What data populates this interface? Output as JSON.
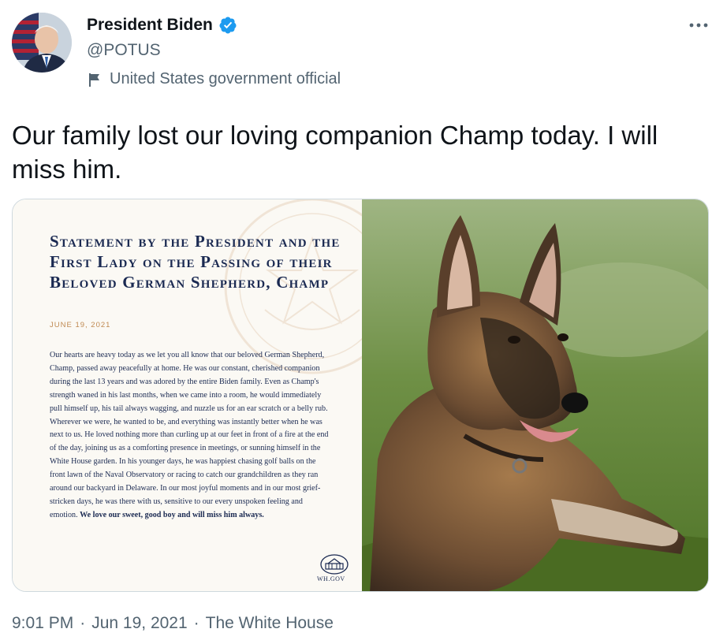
{
  "author": {
    "name": "President Biden",
    "handle": "@POTUS",
    "label": "United States government official",
    "verified": true
  },
  "icons": {
    "verified": "verified-badge-icon",
    "label": "flag-icon",
    "more": "more-options-icon"
  },
  "tweet": {
    "text": "Our family lost our loving companion Champ today. I will miss him."
  },
  "media": {
    "statement": {
      "title": "Statement by the President and the First Lady on the Passing of their Beloved German Shepherd, Champ",
      "date": "JUNE 19, 2021",
      "body": "Our hearts are heavy today as we let you all know that our beloved German Shepherd, Champ, passed away peacefully at home. He was our constant, cherished companion during the last 13 years and was adored by the entire Biden family. Even as Champ's strength waned in his last months, when we came into a room, he would immediately pull himself up, his tail always wagging, and nuzzle us for an ear scratch or a belly rub. Wherever we were, he wanted to be, and everything was instantly better when he was next to us. He loved nothing more than curling up at our feet in front of a fire at the end of the day, joining us as a comforting presence in meetings, or sunning himself in the White House garden. In his younger days, he was happiest chasing golf balls on the front lawn of the Naval Observatory or racing to catch our grandchildren as they ran around our backyard in Delaware. In our most joyful moments and in our most grief-stricken days, he was there with us, sensitive to our every unspoken feeling and emotion.",
      "closing": "We love our sweet, good boy and will miss him always.",
      "footer_logo": "WH.GOV"
    },
    "photo_subject": "german-shepherd-photo"
  },
  "meta": {
    "time": "9:01 PM",
    "date": "Jun 19, 2021",
    "source": "The White House",
    "separator": "·"
  },
  "colors": {
    "text_primary": "#0f1419",
    "text_secondary": "#536471",
    "verified_blue": "#1d9bf0",
    "statement_navy": "#1b2a52",
    "statement_accent": "#c08a52"
  }
}
